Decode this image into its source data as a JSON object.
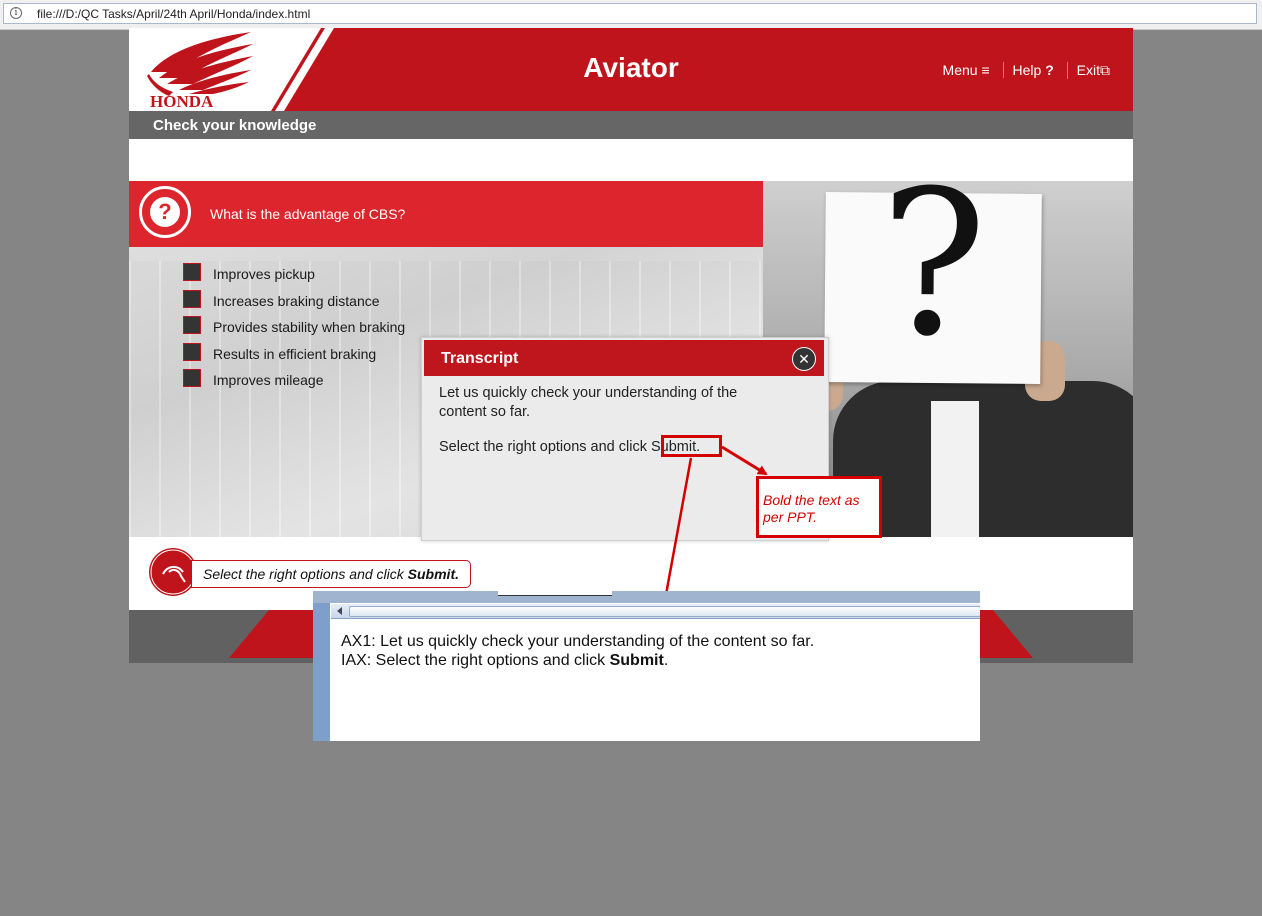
{
  "browser": {
    "url": "file:///D:/QC Tasks/April/24th April/Honda/index.html"
  },
  "header": {
    "brand": "HONDA",
    "title": "Aviator",
    "nav": [
      {
        "label": "Menu",
        "icon": "≡"
      },
      {
        "label": "Help",
        "icon": "?"
      },
      {
        "label": "Exit",
        "icon": "⧉"
      }
    ]
  },
  "subheader": {
    "title": "Check your knowledge"
  },
  "question": {
    "text": "What is the advantage of CBS?",
    "options": [
      "Improves pickup",
      "Increases braking distance",
      "Provides stability when braking",
      "Results in efficient braking",
      "Improves mileage"
    ]
  },
  "instruction": {
    "prefix": "Select the right options and click ",
    "bold": "Submit."
  },
  "transcript": {
    "title": "Transcript",
    "close": "✕",
    "line1": "Let us quickly check your understanding of the content so far.",
    "line2_prefix": "Select the right options and click ",
    "line2_submit": "Submit."
  },
  "annotation": {
    "note": "Bold the text as per PPT."
  },
  "ppt_notes": {
    "line1": "AX1: Let us quickly check your understanding of the content so far.",
    "line2_prefix": "IAX: Select the right options and click ",
    "line2_bold": "Submit",
    "line2_suffix": "."
  },
  "colors": {
    "brand_red": "#c0141c",
    "question_red": "#dc252c",
    "annotation_red": "#d40000"
  }
}
